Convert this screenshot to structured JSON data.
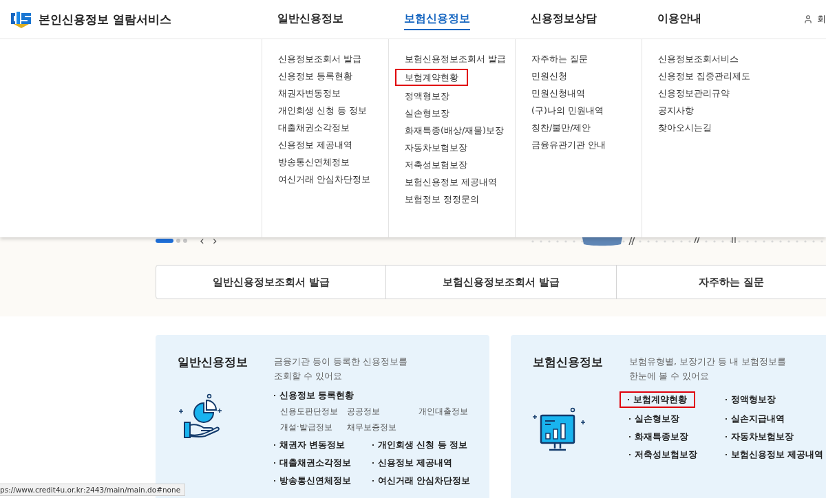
{
  "site": {
    "title": "본인신용정보 열람서비스",
    "user_link": "회"
  },
  "nav": [
    {
      "label": "일반신용정보",
      "selected": false,
      "menu": [
        {
          "label": "신용정보조회서 발급",
          "highlighted": false
        },
        {
          "label": "신용정보 등록현황",
          "highlighted": false
        },
        {
          "label": "채권자변동정보",
          "highlighted": false
        },
        {
          "label": "개인회생 신청 등 정보",
          "highlighted": false
        },
        {
          "label": "대출채권소각정보",
          "highlighted": false
        },
        {
          "label": "신용정보 제공내역",
          "highlighted": false
        },
        {
          "label": "방송통신연체정보",
          "highlighted": false
        },
        {
          "label": "여신거래 안심차단정보",
          "highlighted": false
        }
      ]
    },
    {
      "label": "보험신용정보",
      "selected": true,
      "menu": [
        {
          "label": "보험신용정보조회서 발급",
          "highlighted": false
        },
        {
          "label": "보험계약현황",
          "highlighted": true
        },
        {
          "label": "정액형보장",
          "highlighted": false
        },
        {
          "label": "실손형보장",
          "highlighted": false
        },
        {
          "label": "화재특종(배상/재물)보장",
          "highlighted": false
        },
        {
          "label": "자동차보험보장",
          "highlighted": false
        },
        {
          "label": "저축성보험보장",
          "highlighted": false
        },
        {
          "label": "보험신용정보 제공내역",
          "highlighted": false
        },
        {
          "label": "보험정보 정정문의",
          "highlighted": false
        }
      ]
    },
    {
      "label": "신용정보상담",
      "selected": false,
      "menu": [
        {
          "label": "자주하는 질문",
          "highlighted": false
        },
        {
          "label": "민원신청",
          "highlighted": false
        },
        {
          "label": "민원신청내역",
          "highlighted": false
        },
        {
          "label": "(구)나의 민원내역",
          "highlighted": false
        },
        {
          "label": "칭찬/불만/제안",
          "highlighted": false
        },
        {
          "label": "금융유관기관 안내",
          "highlighted": false
        }
      ]
    },
    {
      "label": "이용안내",
      "selected": false,
      "menu": [
        {
          "label": "신용정보조회서비스",
          "highlighted": false
        },
        {
          "label": "신용정보 집중관리제도",
          "highlighted": false
        },
        {
          "label": "신용정보관리규약",
          "highlighted": false
        },
        {
          "label": "공지사항",
          "highlighted": false
        },
        {
          "label": "찾아오시는길",
          "highlighted": false
        }
      ]
    }
  ],
  "slider": {
    "pages": [
      {
        "selected": true
      },
      {
        "selected": false
      },
      {
        "selected": false
      }
    ],
    "prev": "‹",
    "next": "›"
  },
  "quick_buttons": [
    "일반신용정보조회서 발급",
    "보험신용정보조회서 발급",
    "자주하는 질문"
  ],
  "cards": [
    {
      "kind": "general",
      "title": "일반신용정보",
      "description_lines": [
        "금융기관 등이 등록한 신용정보를",
        "조회할 수 있어요"
      ],
      "featured": {
        "label": "신용정보 등록현황",
        "sub_items": [
          "신용도판단정보",
          "공공정보",
          "개인대출정보",
          "개설·발급정보",
          "채무보증정보"
        ]
      },
      "links": [
        {
          "label": "채권자 변동정보",
          "highlighted": false
        },
        {
          "label": "개인회생 신청 등 정보",
          "highlighted": false
        },
        {
          "label": "대출채권소각정보",
          "highlighted": false
        },
        {
          "label": "신용정보 제공내역",
          "highlighted": false
        },
        {
          "label": "방송통신연체정보",
          "highlighted": false
        },
        {
          "label": "여신거래 안심차단정보",
          "highlighted": false
        }
      ]
    },
    {
      "kind": "insurance",
      "title": "보험신용정보",
      "description_lines": [
        "보험유형별, 보장기간 등 내 보험정보를",
        "한눈에 볼 수 있어요"
      ],
      "links": [
        {
          "label": "보험계약현황",
          "highlighted": true
        },
        {
          "label": "정액형보장",
          "highlighted": false
        },
        {
          "label": "실손형보장",
          "highlighted": false
        },
        {
          "label": "실손지급내역",
          "highlighted": false
        },
        {
          "label": "화재특종보장",
          "highlighted": false
        },
        {
          "label": "자동차보험보장",
          "highlighted": false
        },
        {
          "label": "저축성보험보장",
          "highlighted": false
        },
        {
          "label": "보험신용정보 제공내역",
          "highlighted": false
        }
      ]
    }
  ],
  "status_url": "ps://www.credit4u.or.kr:2443/main/main.do#none"
}
